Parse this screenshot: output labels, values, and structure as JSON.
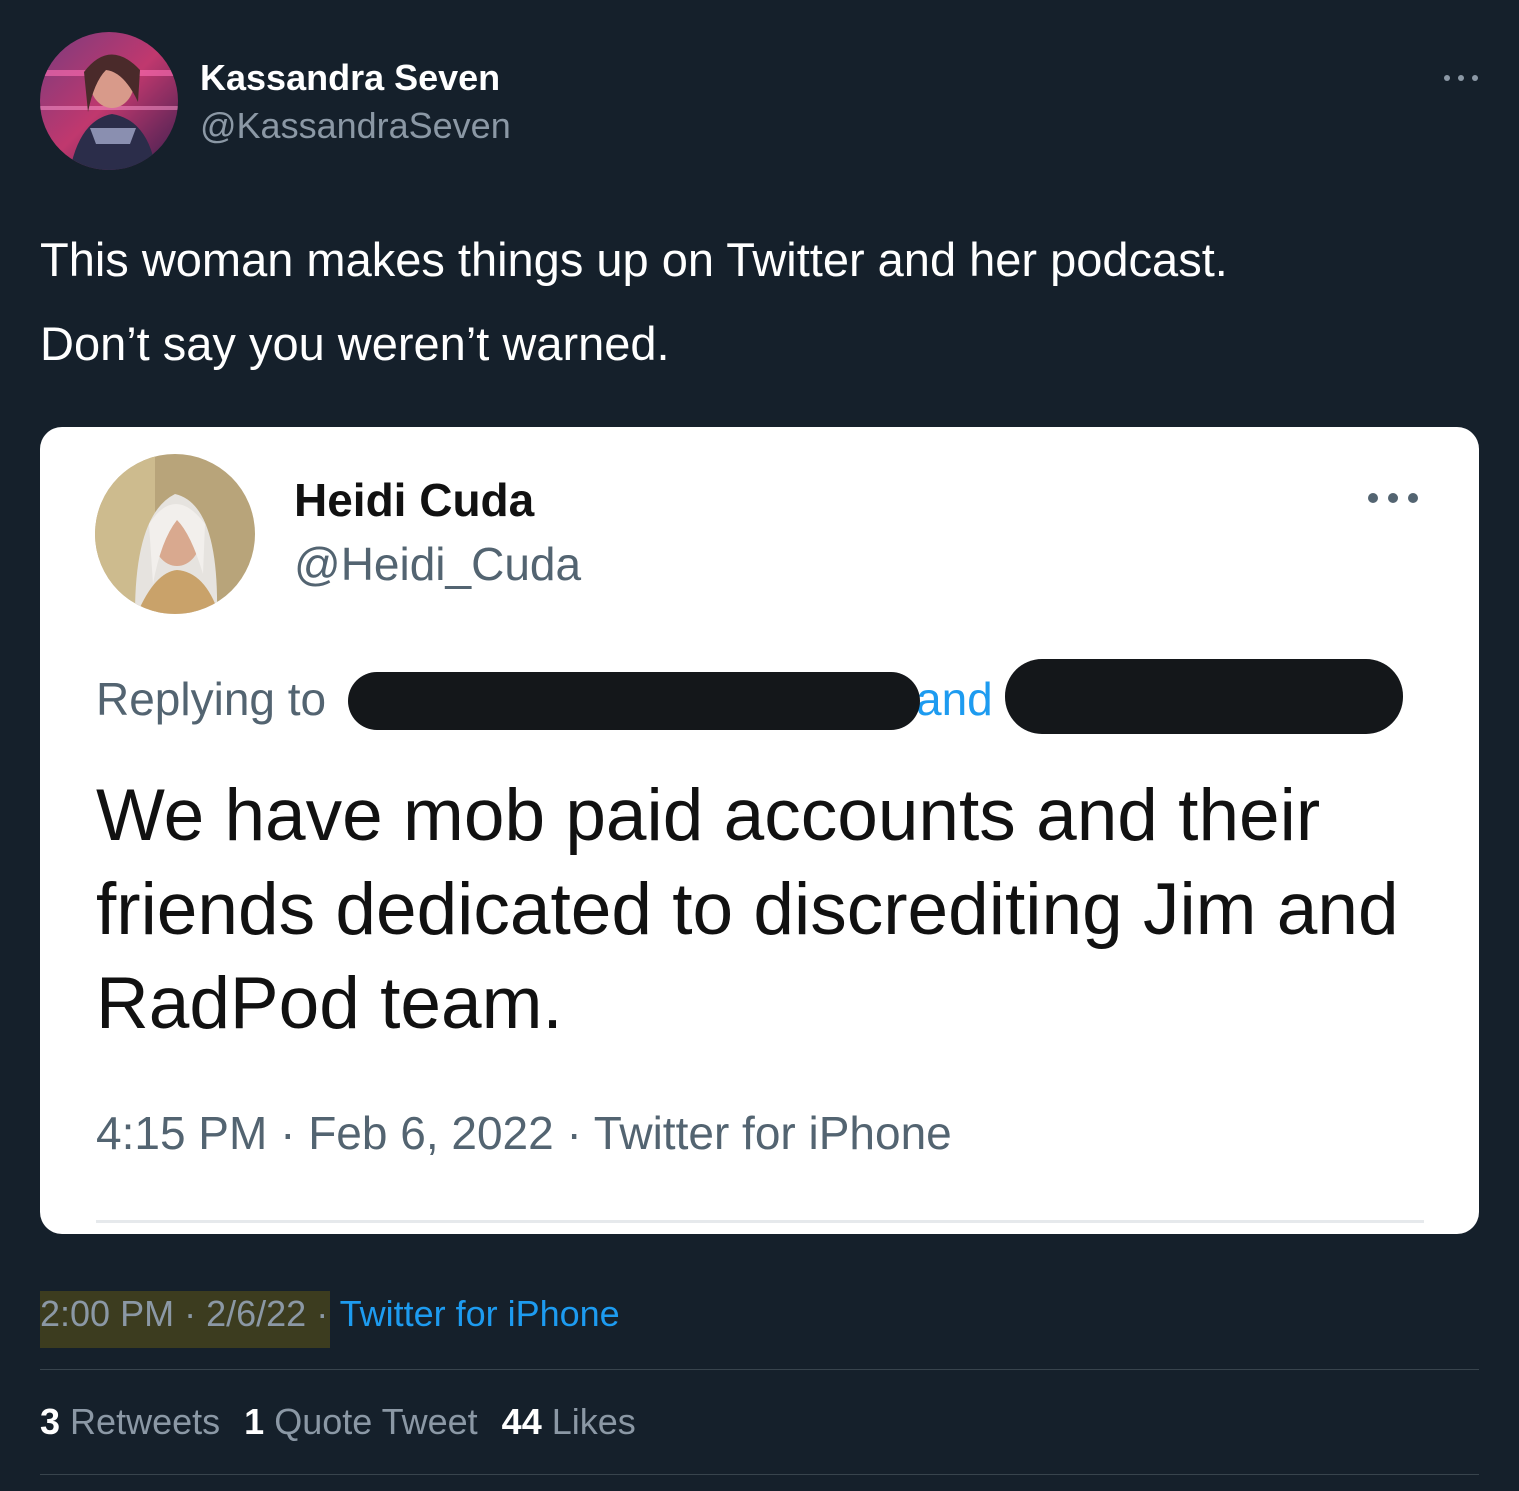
{
  "author": {
    "display_name": "Kassandra Seven",
    "handle": "@KassandraSeven",
    "avatar_icon": "avatar-portrait"
  },
  "tweet": {
    "lines": [
      "This woman makes things up on Twitter and her podcast.",
      "Don’t say you weren’t warned."
    ]
  },
  "embedded": {
    "display_name": "Heidi Cuda",
    "handle": "@Heidi_Cuda",
    "replying_to": "Replying to",
    "and_text": "and",
    "body": "We have mob paid accounts and their friends dedicated to discrediting Jim and RadPod team.",
    "time": "4:15 PM",
    "date": "Feb 6, 2022",
    "source": "Twitter for iPhone",
    "sep": "·"
  },
  "meta": {
    "time": "2:00 PM",
    "date": "2/6/22",
    "source": "Twitter for iPhone",
    "sep": "·"
  },
  "stats": [
    {
      "count": "3",
      "label": "Retweets"
    },
    {
      "count": "1",
      "label": "Quote Tweet"
    },
    {
      "count": "44",
      "label": "Likes"
    }
  ],
  "colors": {
    "background": "#15202b",
    "link": "#1d9bf0",
    "muted": "#8b98a5",
    "highlight": "#3c3c1f"
  }
}
